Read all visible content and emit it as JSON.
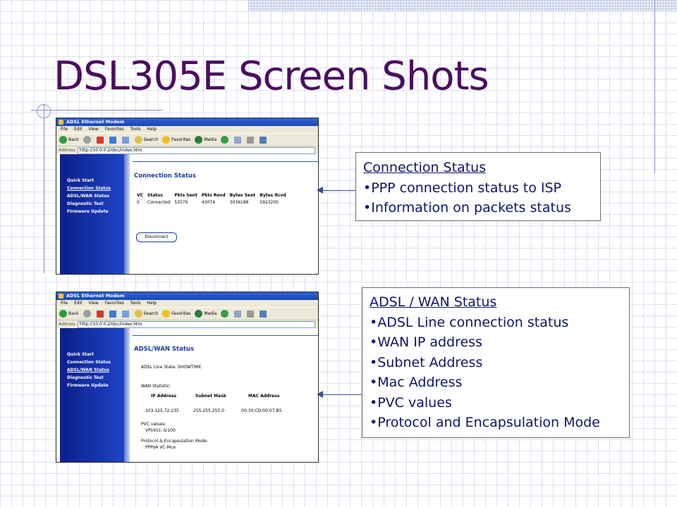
{
  "slide": {
    "title": "DSL305E Screen Shots"
  },
  "shot1": {
    "window_title": "ADSL Ethernet Modem",
    "menu": [
      "File",
      "Edit",
      "View",
      "Favorites",
      "Tools",
      "Help"
    ],
    "toolbar": {
      "back": "Back",
      "search": "Search",
      "favorites": "Favorites",
      "media": "Media"
    },
    "address_label": "Address",
    "address_url": "http://10.0.0.2/doc/index.htm",
    "sidebar": [
      "Quick Start",
      "Connection Status",
      "ADSL/WAN Status",
      "Diagnostic Test",
      "Firmware Update"
    ],
    "heading": "Connection Status",
    "table": {
      "headers": [
        "VC",
        "Status",
        "Pkts Sent",
        "Pkts Revd",
        "Bytes Sent",
        "Bytes Rcvd"
      ],
      "row": [
        "0",
        "Connected",
        "53576",
        "43074",
        "3036188",
        "5923200"
      ]
    },
    "button": "Disconnect"
  },
  "shot2": {
    "window_title": "ADSL Ethernet Modem",
    "menu": [
      "File",
      "Edit",
      "View",
      "Favorites",
      "Tools",
      "Help"
    ],
    "toolbar": {
      "back": "Back",
      "search": "Search",
      "favorites": "Favorites",
      "media": "Media"
    },
    "address_label": "Address",
    "address_url": "http://10.0.0.2/doc/index.htm",
    "sidebar": [
      "Quick Start",
      "Connection Status",
      "ADSL/WAN Status",
      "Diagnostic Test",
      "Firmware Update"
    ],
    "heading": "ADSL/WAN Status",
    "line_state": "ADSL Line State:   SHOWTIME",
    "wan_statistic": "WAN Statistic:",
    "wan_headers": [
      "IP Address",
      "Subnet Mask",
      "MAC Address"
    ],
    "wan_values": [
      "203.125.72.235",
      "255.255.255.0",
      "00:30:CD:00:07:B5"
    ],
    "pvc_label": "PVC values:",
    "pvc_value": "VPI/VCI:  0/100",
    "protocol_label": "Protocol & Encapsulation Mode:",
    "protocol_value": "PPPoA VC-Mux"
  },
  "callout1": {
    "heading": "Connection Status",
    "bullets": [
      "PPP connection status to ISP",
      "Information on packets status"
    ]
  },
  "callout2": {
    "heading": "ADSL / WAN Status",
    "bullets": [
      "ADSL Line connection status",
      "WAN IP address",
      "Subnet Address",
      "Mac Address",
      "PVC values",
      "Protocol and Encapsulation Mode"
    ]
  }
}
